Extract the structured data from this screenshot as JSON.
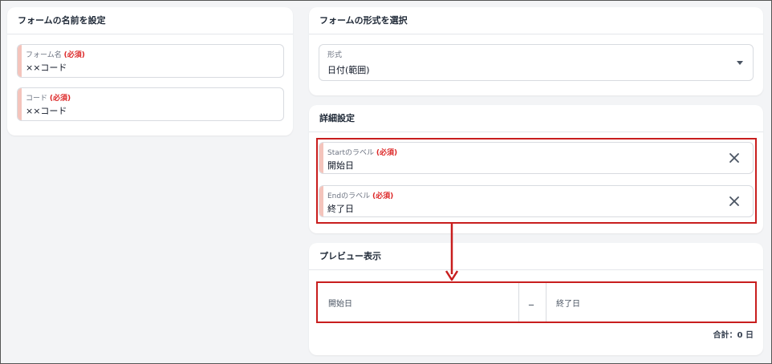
{
  "form_name_card": {
    "title": "フォームの名前を設定",
    "name_field": {
      "label": "フォーム名",
      "required_mark": "(必須)",
      "value": "××コード"
    },
    "code_field": {
      "label": "コード",
      "required_mark": "(必須)",
      "value": "××コード"
    }
  },
  "form_type_card": {
    "title": "フォームの形式を選択",
    "type_select": {
      "label": "形式",
      "value": "日付(範囲)"
    }
  },
  "detail_card": {
    "title": "詳細設定",
    "start_label_field": {
      "label": "Startのラベル",
      "required_mark": "(必須)",
      "value": "開始日"
    },
    "end_label_field": {
      "label": "Endのラベル",
      "required_mark": "(必須)",
      "value": "終了日"
    }
  },
  "preview_card": {
    "title": "プレビュー表示",
    "start_placeholder": "開始日",
    "separator": "_",
    "end_placeholder": "終了日",
    "total": "合計：0 日"
  },
  "colors": {
    "highlight": "#c81e1e",
    "required_mark": "#dc2626",
    "required_accent": "#f4c4bc"
  }
}
